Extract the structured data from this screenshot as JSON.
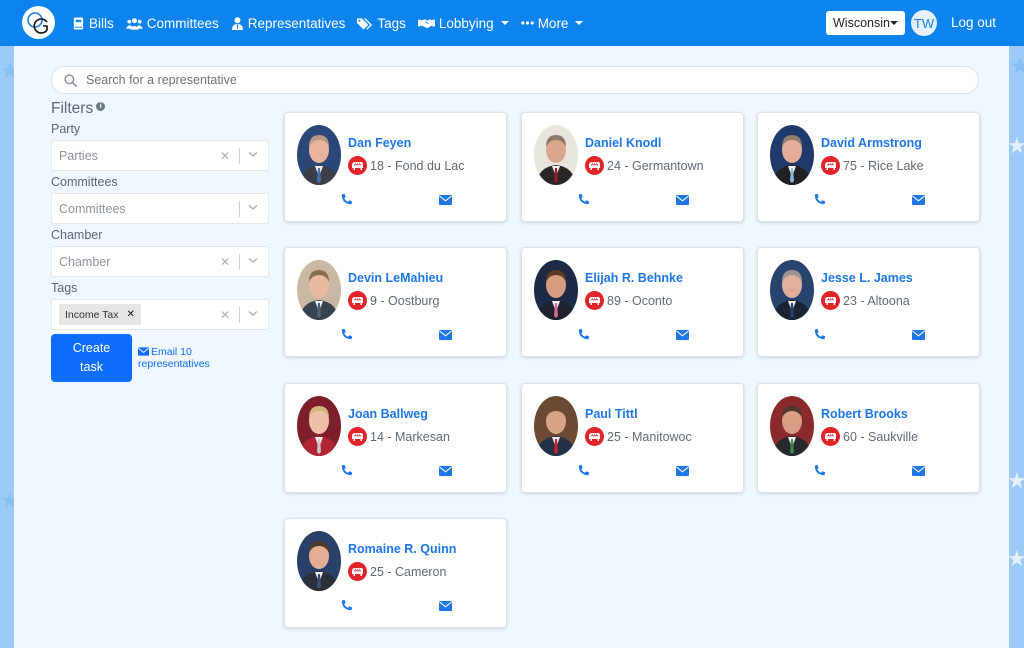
{
  "navbar": {
    "logo_text": "OG",
    "items": [
      {
        "label": "Bills",
        "icon": "book-icon",
        "dropdown": false
      },
      {
        "label": "Committees",
        "icon": "users-icon",
        "dropdown": false
      },
      {
        "label": "Representatives",
        "icon": "user-tie-icon",
        "dropdown": false
      },
      {
        "label": "Tags",
        "icon": "tags-icon",
        "dropdown": false
      },
      {
        "label": "Lobbying",
        "icon": "handshake-icon",
        "dropdown": true
      },
      {
        "label": "More",
        "icon": "ellipsis-icon",
        "dropdown": true
      }
    ],
    "state_selected": "Wisconsin",
    "avatar_initials": "TW",
    "logout_label": "Log out"
  },
  "search": {
    "placeholder": "Search for a representative",
    "value": ""
  },
  "filters": {
    "title": "Filters",
    "party": {
      "label": "Party",
      "placeholder": "Parties"
    },
    "committees": {
      "label": "Committees",
      "placeholder": "Committees"
    },
    "chamber": {
      "label": "Chamber",
      "placeholder": "Chamber"
    },
    "tags": {
      "label": "Tags",
      "selected": [
        "Income Tax"
      ]
    },
    "create_task_label": "Create task",
    "email_label": "Email 10 representatives"
  },
  "colors": {
    "navbar": "#0d83ee",
    "link": "#1f77e5",
    "primary_button": "#0d6efd",
    "republican": "#e0242a"
  },
  "representatives": [
    {
      "name": "Dan Feyen",
      "district": "18",
      "city": "Fond du Lac",
      "party": "Republican"
    },
    {
      "name": "Daniel Knodl",
      "district": "24",
      "city": "Germantown",
      "party": "Republican"
    },
    {
      "name": "David Armstrong",
      "district": "75",
      "city": "Rice Lake",
      "party": "Republican"
    },
    {
      "name": "Devin LeMahieu",
      "district": "9",
      "city": "Oostburg",
      "party": "Republican"
    },
    {
      "name": "Elijah R. Behnke",
      "district": "89",
      "city": "Oconto",
      "party": "Republican"
    },
    {
      "name": "Jesse L. James",
      "district": "23",
      "city": "Altoona",
      "party": "Republican"
    },
    {
      "name": "Joan Ballweg",
      "district": "14",
      "city": "Markesan",
      "party": "Republican"
    },
    {
      "name": "Paul Tittl",
      "district": "25",
      "city": "Manitowoc",
      "party": "Republican"
    },
    {
      "name": "Robert Brooks",
      "district": "60",
      "city": "Saukville",
      "party": "Republican"
    },
    {
      "name": "Romaine R. Quinn",
      "district": "25",
      "city": "Cameron",
      "party": "Republican"
    }
  ]
}
